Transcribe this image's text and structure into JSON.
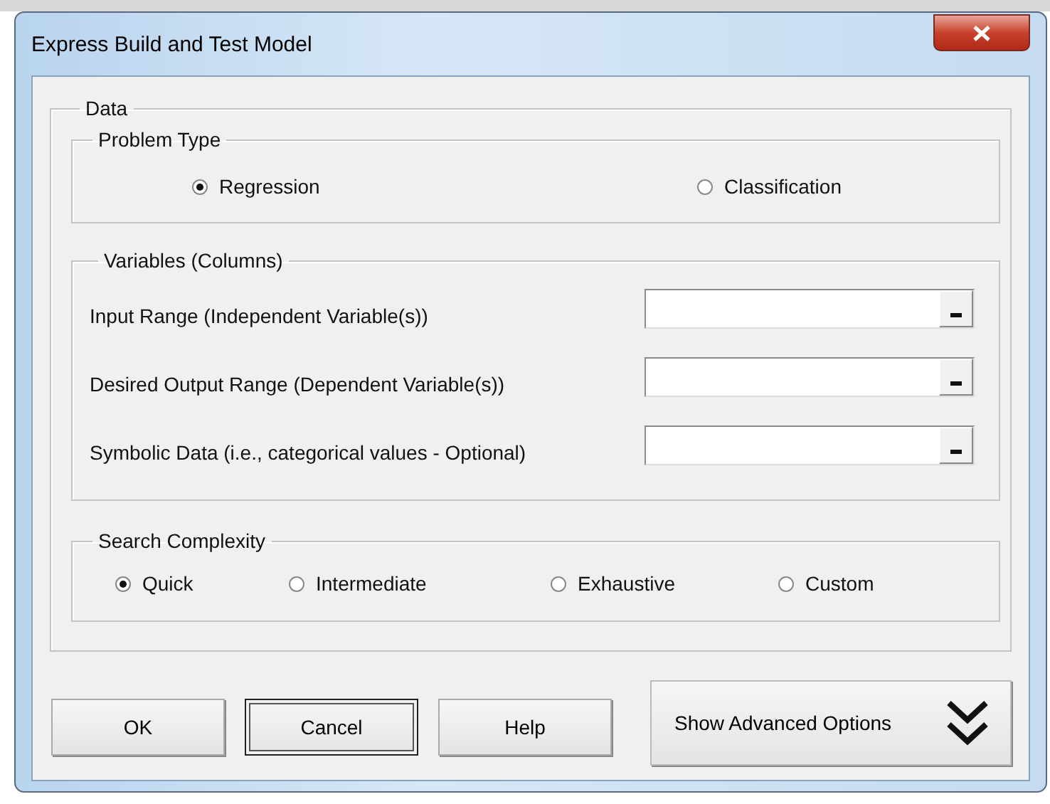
{
  "window": {
    "title": "Express Build and Test Model"
  },
  "data_group": {
    "label": "Data",
    "problem_type": {
      "label": "Problem Type",
      "options": [
        {
          "label": "Regression",
          "selected": true
        },
        {
          "label": "Classification",
          "selected": false
        }
      ]
    },
    "variables": {
      "label": "Variables (Columns)",
      "fields": [
        {
          "label": "Input Range (Independent Variable(s))"
        },
        {
          "label": "Desired Output Range (Dependent Variable(s))"
        },
        {
          "label": "Symbolic Data (i.e., categorical values - Optional)"
        }
      ]
    },
    "search_complexity": {
      "label": "Search Complexity",
      "options": [
        {
          "label": "Quick",
          "selected": true
        },
        {
          "label": "Intermediate",
          "selected": false
        },
        {
          "label": "Exhaustive",
          "selected": false
        },
        {
          "label": "Custom",
          "selected": false
        }
      ]
    }
  },
  "buttons": [
    {
      "label": "OK",
      "focused": false
    },
    {
      "label": "Cancel",
      "focused": true
    },
    {
      "label": "Help",
      "focused": false
    }
  ],
  "advanced_button": {
    "label": "Show Advanced Options"
  }
}
